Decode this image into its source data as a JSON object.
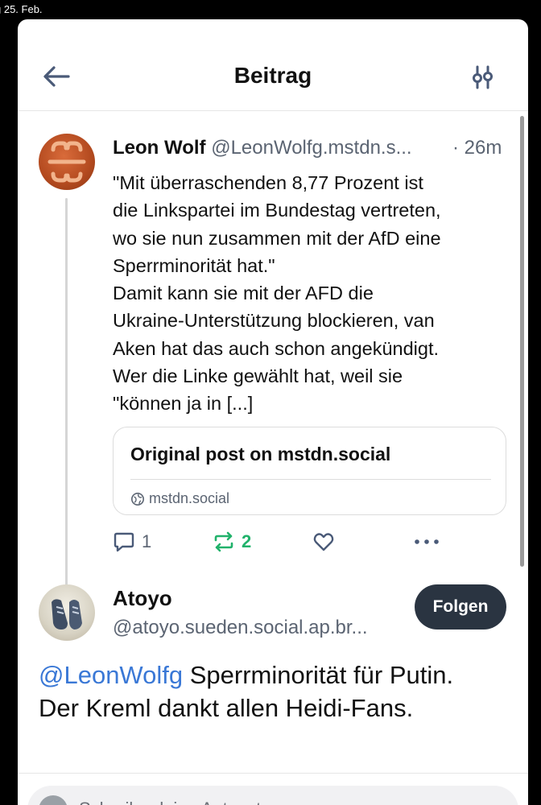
{
  "status_bar": {
    "date_text": "g 25. Feb."
  },
  "header": {
    "title": "Beitrag",
    "back_icon": "arrow-left-icon",
    "settings_icon": "sliders-icon"
  },
  "post": {
    "author_name": "Leon Wolf",
    "author_handle": "@LeonWolfg.mstdn.s...",
    "time": "· 26m",
    "lines": [
      "\"Mit überraschenden 8,77 Prozent ist",
      "die Linkspartei im Bundestag vertreten,",
      "wo sie nun zusammen mit der AfD eine",
      "Sperrminorität hat.\"",
      "Damit kann sie mit der AFD die",
      "Ukraine-Unterstützung blockieren, van",
      "Aken hat das auch schon angekündigt.",
      "Wer die Linke gewählt hat, weil sie",
      "\"können ja in [...]"
    ],
    "link_card": {
      "title": "Original post on mstdn.social",
      "domain": "mstdn.social"
    },
    "actions": {
      "reply_count": "1",
      "boost_count": "2"
    }
  },
  "reply": {
    "author_name": "Atoyo",
    "author_handle": "@atoyo.sueden.social.ap.br...",
    "follow_label": "Folgen",
    "mention": "@LeonWolfg",
    "text_line1": " Sperrminorität für Putin.",
    "text_line2": "Der Kreml dankt allen Heidi-Fans."
  },
  "composer": {
    "placeholder": "Schreibe deine Antwort ..."
  },
  "colors": {
    "accent": "#3a78d6",
    "boost": "#21b26b",
    "follow_button": "#2a3441",
    "muted": "#5b6472"
  }
}
